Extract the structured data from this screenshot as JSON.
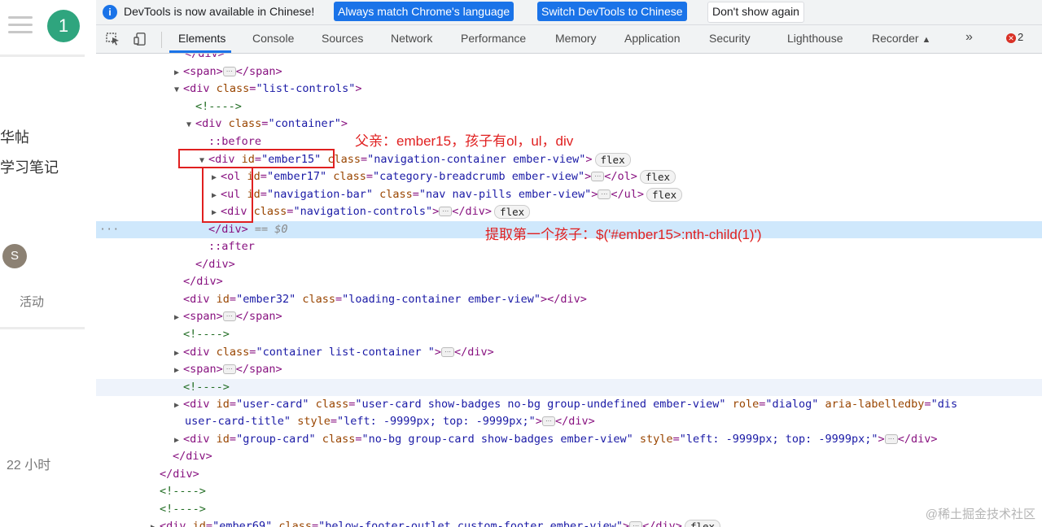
{
  "left_page": {
    "badge": "1",
    "text1": "华帖",
    "text2": "学习笔记",
    "avatar": "S",
    "activity": "活动",
    "time": "22 小时"
  },
  "infobar": {
    "message": "DevTools is now available in Chinese!",
    "btn_match": "Always match Chrome's language",
    "btn_switch": "Switch DevTools to Chinese",
    "btn_dismiss": "Don't show again"
  },
  "tabs": [
    "Elements",
    "Console",
    "Sources",
    "Network",
    "Performance",
    "Memory",
    "Application",
    "Security",
    "Lighthouse",
    "Recorder"
  ],
  "more_tabs": "»",
  "error_count": "2",
  "tree": {
    "r0": "</div>",
    "r1_tag": "<span>",
    "r1_close": "</span>",
    "r2_tag": "<div",
    "r2_attr": "class",
    "r2_val": "\"list-controls\"",
    "r2_end": ">",
    "r3": "<!---->",
    "r4_tag": "<div",
    "r4_attr": "class",
    "r4_val": "\"container\"",
    "r4_end": ">",
    "r5": "::before",
    "r6_tag": "<div",
    "r6_attr1": "id",
    "r6_val1": "\"ember15\"",
    "r6_attr2": "class",
    "r6_val2": "\"navigation-container ember-view\"",
    "r6_end": ">",
    "r7_tag": "<ol",
    "r7_attr1": "id",
    "r7_val1": "\"ember17\"",
    "r7_attr2": "class",
    "r7_val2": "\"category-breadcrumb ember-view\"",
    "r7_end": ">",
    "r7_close": "</ol>",
    "r8_tag": "<ul",
    "r8_attr1": "id",
    "r8_val1": "\"navigation-bar\"",
    "r8_attr2": "class",
    "r8_val2": "\"nav nav-pills ember-view\"",
    "r8_end": ">",
    "r8_close": "</ul>",
    "r9_tag": "<div",
    "r9_attr": "class",
    "r9_val": "\"navigation-controls\"",
    "r9_end": ">",
    "r9_close": "</div>",
    "r10_close": "</div>",
    "r10_eq": " == $0",
    "r11": "::after",
    "r12": "</div>",
    "r13": "</div>",
    "r14_tag": "<div",
    "r14_attr1": "id",
    "r14_val1": "\"ember32\"",
    "r14_attr2": "class",
    "r14_val2": "\"loading-container ember-view\"",
    "r14_end": "></div>",
    "r15_tag": "<span>",
    "r15_close": "</span>",
    "r16": "<!---->",
    "r17_tag": "<div",
    "r17_attr": "class",
    "r17_val": "\"container list-container \"",
    "r17_end": ">",
    "r17_close": "</div>",
    "r18_tag": "<span>",
    "r18_close": "</span>",
    "r19": "<!---->",
    "r20_tag": "<div",
    "r20_attr1": "id",
    "r20_val1": "\"user-card\"",
    "r20_attr2": "class",
    "r20_val2": "\"user-card show-badges no-bg group-undefined ember-view\"",
    "r20_attr3": "role",
    "r20_val3": "\"dialog\"",
    "r20_attr4": "aria-labelledby",
    "r20_val4": "\"dis",
    "r21_val": "user-card-title\"",
    "r21_attr": "style",
    "r21_val2": "\"left: -9999px; top: -9999px;\"",
    "r21_end": ">",
    "r21_close": "</div>",
    "r22_tag": "<div",
    "r22_attr1": "id",
    "r22_val1": "\"group-card\"",
    "r22_attr2": "class",
    "r22_val2": "\"no-bg group-card show-badges ember-view\"",
    "r22_attr3": "style",
    "r22_val3": "\"left: -9999px; top: -9999px;\"",
    "r22_end": ">",
    "r22_close": "</div>",
    "r23": "</div>",
    "r24": "</div>",
    "r25": "<!---->",
    "r26": "<!---->",
    "r27_tag": "<div",
    "r27_attr1": "id",
    "r27_val1": "\"ember69\"",
    "r27_attr2": "class",
    "r27_val2": "\"below-footer-outlet custom-footer ember-view\"",
    "r27_end": ">",
    "r27_close": "</div>",
    "flex": "flex",
    "dots": "···"
  },
  "annotations": {
    "parent_note": "父亲：ember15，孩子有ol，ul，div",
    "child_note": "提取第一个孩子：$('#ember15>:nth-child(1)')",
    "color": "#e02020"
  },
  "watermark": "@稀土掘金技术社区"
}
